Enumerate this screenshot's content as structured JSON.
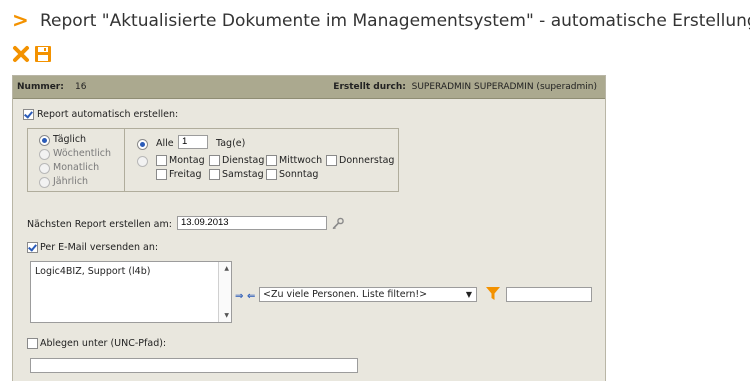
{
  "page": {
    "title_marker": ">",
    "title": "Report \"Aktualisierte Dokumente im Managementsystem\" - automatische Erstellung:"
  },
  "toolbar": {
    "icons": [
      "cancel-icon",
      "save-icon"
    ],
    "accent": "#f39200"
  },
  "header": {
    "number_label": "Nummer:",
    "number_value": "16",
    "created_by_label": "Erstellt durch:",
    "created_by_value": "SUPERADMIN SUPERADMIN (superadmin)"
  },
  "auto": {
    "label": "Report automatisch erstellen:",
    "checked": true
  },
  "frequency": {
    "options": [
      "Täglich",
      "Wöchentlich",
      "Monatlich",
      "Jährlich"
    ],
    "selected": "Täglich"
  },
  "interval": {
    "every_label": "Alle",
    "every_value": "1",
    "unit": "Tag(e)",
    "days": [
      "Montag",
      "Dienstag",
      "Mittwoch",
      "Donnerstag",
      "Freitag",
      "Samstag",
      "Sonntag"
    ]
  },
  "next_report": {
    "label": "Nächsten Report erstellen am:",
    "date": "13.09.2013"
  },
  "email": {
    "label": "Per E-Mail versenden an:",
    "checked": true,
    "recipients": [
      "Logic4BIZ, Support (l4b)"
    ],
    "select_value": "<Zu viele Personen. Liste filtern!>",
    "filter_value": ""
  },
  "unc": {
    "label": "Ablegen unter (UNC-Pfad):",
    "checked": false,
    "path": ""
  }
}
